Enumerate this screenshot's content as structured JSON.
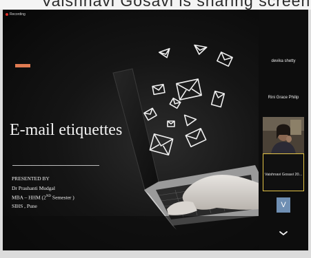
{
  "caption": {
    "text": "Vaishnavi Gosavi is sharing screen"
  },
  "slide": {
    "recording_label": "Recording",
    "title": "E-mail etiquettes",
    "presenter_heading": "PRESENTED BY",
    "presenter_name": "Dr Prashanti Mudgal",
    "program_prefix": "MBA – HHM (2",
    "program_sup": "ND",
    "program_suffix": " Semester )",
    "institute": "SIHS , Pune"
  },
  "participants": {
    "items": [
      {
        "name": "devika shetty"
      },
      {
        "name": "Rini Grace Philip"
      },
      {
        "name": "Vaishnavi Gosavi  20..."
      }
    ],
    "avatar_letter": "V",
    "more_icon": "chevron-down-icon"
  },
  "colors": {
    "accent": "#e07b52",
    "recording": "#e0322a",
    "active_speaker_border": "#e5c547",
    "avatar_bg": "#6f8fb3"
  }
}
